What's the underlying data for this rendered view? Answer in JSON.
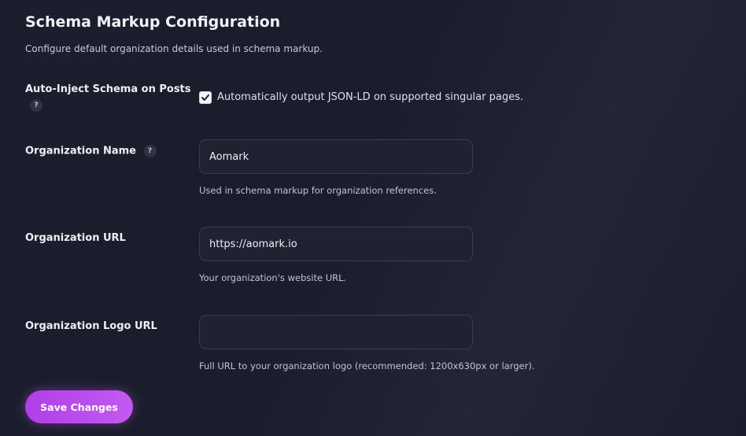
{
  "header": {
    "title": "Schema Markup Configuration",
    "subtitle": "Configure default organization details used in schema markup."
  },
  "auto_inject": {
    "label": "Auto-Inject Schema on Posts",
    "help": "?",
    "checked": true,
    "checkbox_text": "Automatically output JSON-LD on supported singular pages."
  },
  "org_name": {
    "label": "Organization Name",
    "help": "?",
    "value": "Aomark",
    "description": "Used in schema markup for organization references."
  },
  "org_url": {
    "label": "Organization URL",
    "value": "https://aomark.io",
    "description": "Your organization's website URL."
  },
  "org_logo": {
    "label": "Organization Logo URL",
    "value": "",
    "description": "Full URL to your organization logo (recommended: 1200x630px or larger)."
  },
  "actions": {
    "save_label": "Save Changes"
  },
  "colors": {
    "background": "#1b1e2d",
    "accent": "#b13fe6",
    "field_background": "#1f2231",
    "field_border": "#3a3e4f"
  },
  "icons": {
    "help": "help-icon",
    "check": "checkmark-icon"
  }
}
